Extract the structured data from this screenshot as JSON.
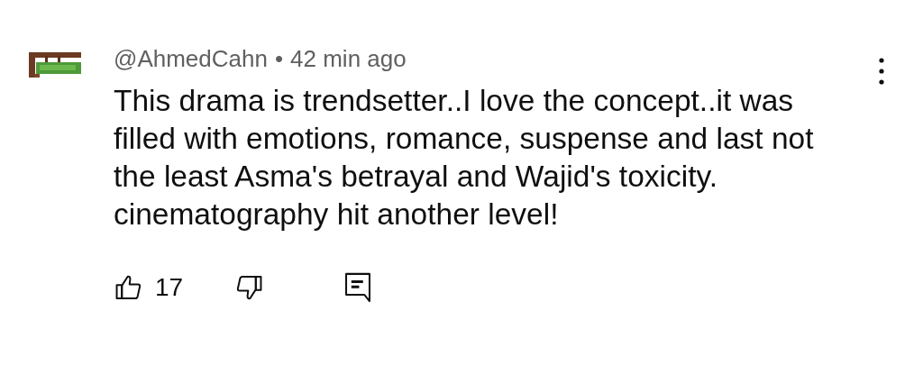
{
  "comment": {
    "author": "@AhmedCahn",
    "separator": "•",
    "time": "42 min ago",
    "text": "This drama is trendsetter..I love the concept..it was filled with emotions, romance, suspense and last not the least Asma's betrayal and Wajid's toxicity. cinematography hit another level!",
    "likes": "17"
  }
}
